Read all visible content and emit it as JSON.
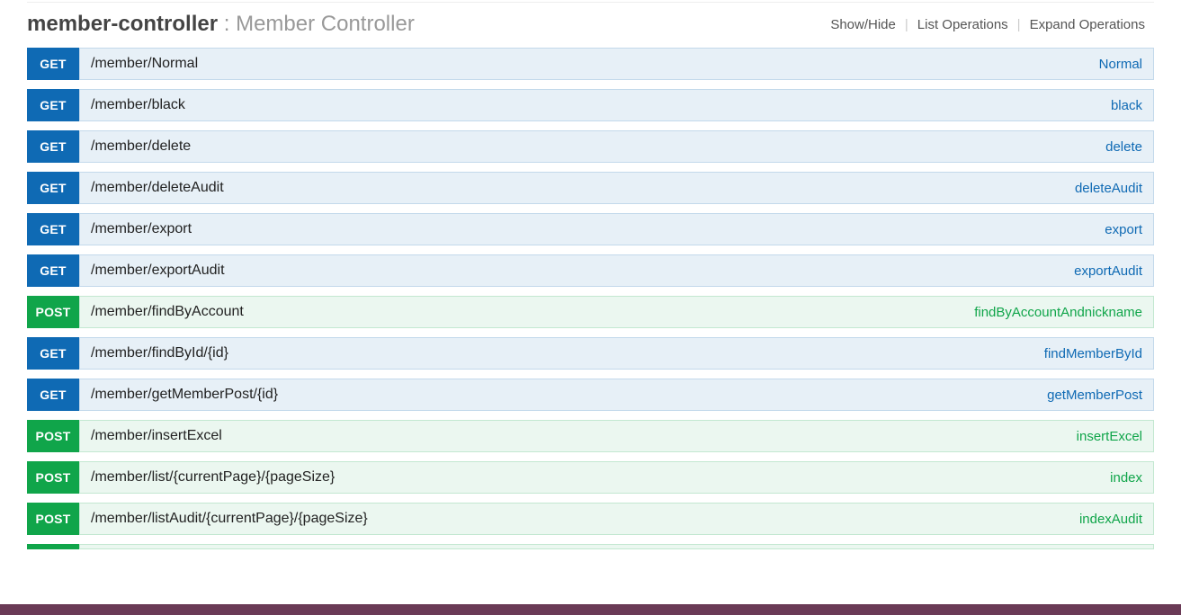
{
  "controller": {
    "name": "member-controller",
    "separator": " : ",
    "description": "Member Controller"
  },
  "options": {
    "showHide": "Show/Hide",
    "listOps": "List Operations",
    "expandOps": "Expand Operations"
  },
  "operations": [
    {
      "method": "GET",
      "path": "/member/Normal",
      "summary": "Normal"
    },
    {
      "method": "GET",
      "path": "/member/black",
      "summary": "black"
    },
    {
      "method": "GET",
      "path": "/member/delete",
      "summary": "delete"
    },
    {
      "method": "GET",
      "path": "/member/deleteAudit",
      "summary": "deleteAudit"
    },
    {
      "method": "GET",
      "path": "/member/export",
      "summary": "export"
    },
    {
      "method": "GET",
      "path": "/member/exportAudit",
      "summary": "exportAudit"
    },
    {
      "method": "POST",
      "path": "/member/findByAccount",
      "summary": "findByAccountAndnickname"
    },
    {
      "method": "GET",
      "path": "/member/findById/{id}",
      "summary": "findMemberById"
    },
    {
      "method": "GET",
      "path": "/member/getMemberPost/{id}",
      "summary": "getMemberPost"
    },
    {
      "method": "POST",
      "path": "/member/insertExcel",
      "summary": "insertExcel"
    },
    {
      "method": "POST",
      "path": "/member/list/{currentPage}/{pageSize}",
      "summary": "index"
    },
    {
      "method": "POST",
      "path": "/member/listAudit/{currentPage}/{pageSize}",
      "summary": "indexAudit"
    }
  ]
}
